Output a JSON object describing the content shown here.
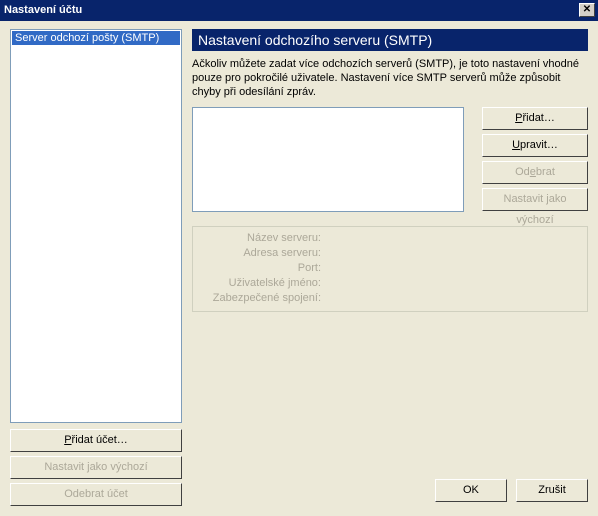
{
  "title": "Nastavení účtu",
  "close_glyph": "✕",
  "sidebar": {
    "tree_item": "Server odchozí pošty (SMTP)",
    "add_account": "Přidat účet…",
    "set_default": "Nastavit jako výchozí",
    "remove_account": "Odebrat účet"
  },
  "main": {
    "heading": "Nastavení odchozího serveru (SMTP)",
    "desc": "Ačkoliv můžete zadat více odchozích serverů (SMTP), je toto nastavení vhodné pouze pro pokročilé uživatele. Nastavení více SMTP serverů může způsobit chyby při odesílání zpráv.",
    "add": "Přidat…",
    "edit": "Upravit…",
    "edit_u": "U",
    "remove": "Odebrat",
    "remove_pre": "Od",
    "remove_u": "e",
    "remove_post": "brat",
    "set_default": "Nastavit jako výchozí",
    "details": {
      "server_name_label": "Název serveru:",
      "server_addr_label": "Adresa serveru:",
      "port_label": "Port:",
      "username_label": "Uživatelské jméno:",
      "secure_label": "Zabezpečené spojení:"
    }
  },
  "footer": {
    "ok": "OK",
    "cancel": "Zrušit"
  }
}
